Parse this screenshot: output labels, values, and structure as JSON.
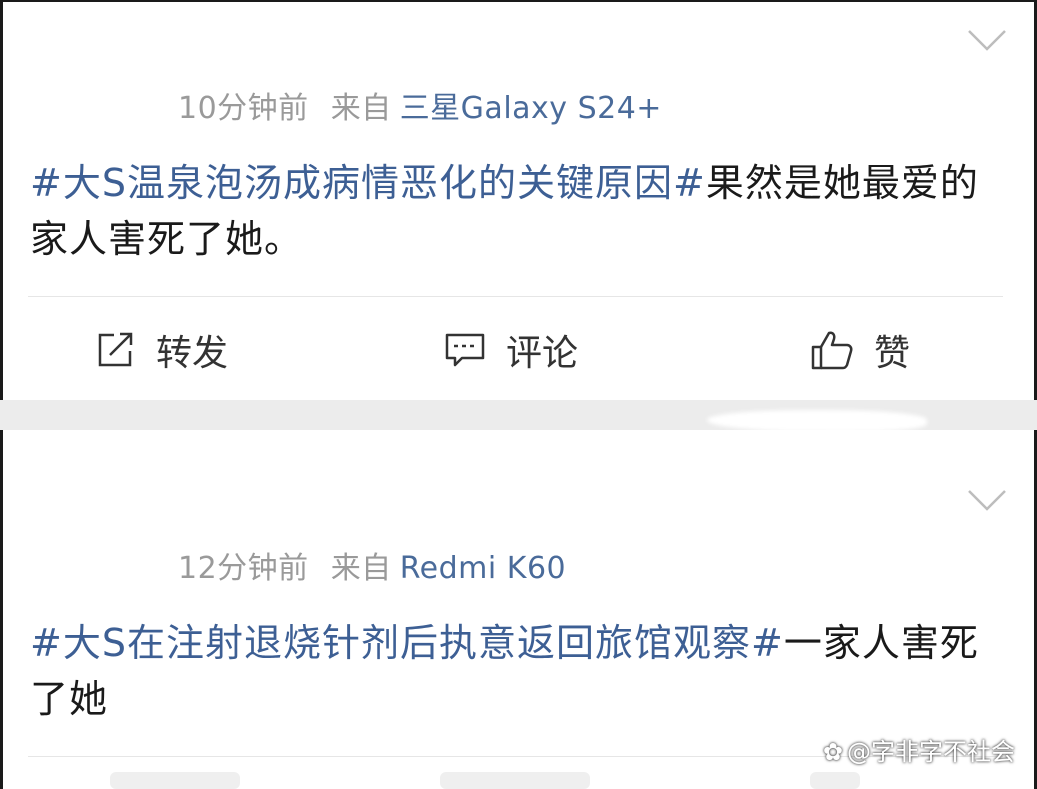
{
  "posts": [
    {
      "time": "10分钟前",
      "source_label": "来自",
      "device": "三星Galaxy S24+",
      "topic": "#大S温泉泡汤成病情恶化的关键原因#",
      "text": "果然是她最爱的家人害死了她。"
    },
    {
      "time": "12分钟前",
      "source_label": "来自",
      "device": "Redmi K60",
      "topic": "#大S在注射退烧针剂后执意返回旅馆观察#",
      "text": "一家人害死了她"
    }
  ],
  "actions": {
    "repost": "转发",
    "comment": "评论",
    "like": "赞"
  },
  "icons": {
    "collapse": "chevron-down-icon",
    "repost": "share-edit-icon",
    "comment": "comment-bubble-icon",
    "like": "thumbs-up-icon"
  },
  "watermark": "@字非字不社会",
  "colors": {
    "topic": "#3d5f94",
    "device": "#4a6b9a",
    "meta": "#9a9a9a",
    "text": "#1a1a1a"
  }
}
